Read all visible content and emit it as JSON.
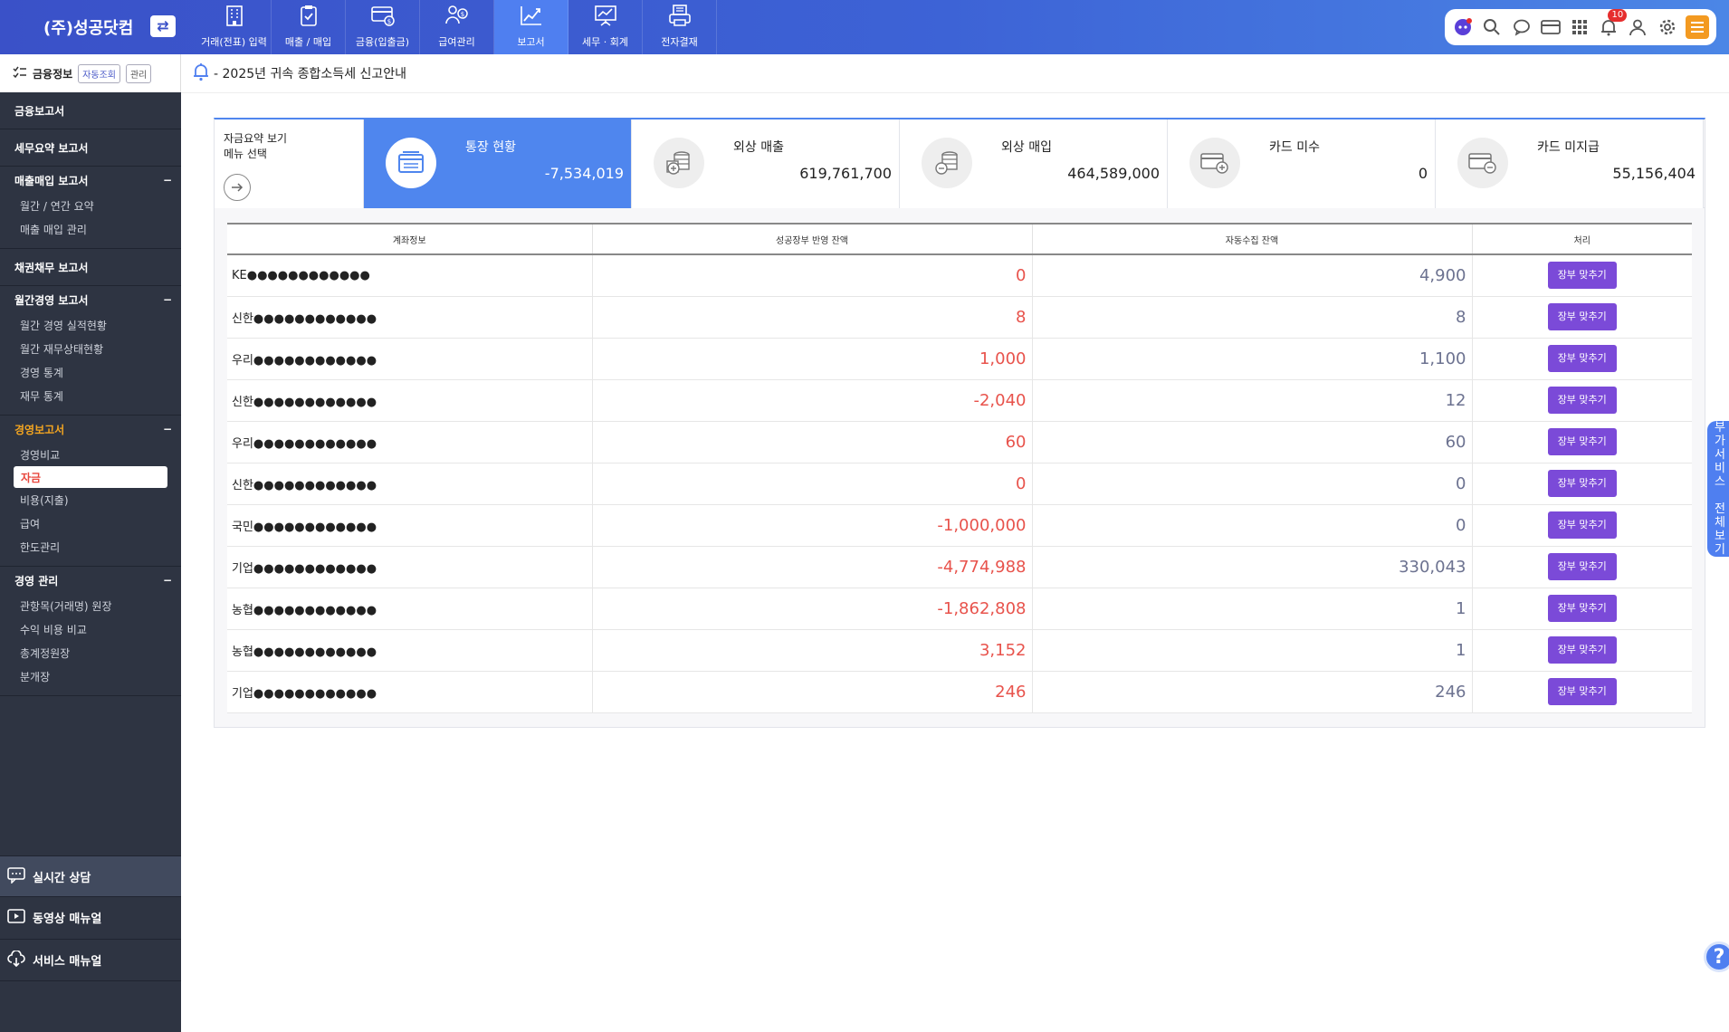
{
  "app": {
    "brand": "(주)성공닷컴"
  },
  "nav": [
    {
      "label": "거래(전표) 입력",
      "icon": "building-icon"
    },
    {
      "label": "매출 / 매입",
      "icon": "clipboard-check-icon"
    },
    {
      "label": "금융(입출금)",
      "icon": "card-money-icon"
    },
    {
      "label": "급여관리",
      "icon": "payroll-icon"
    },
    {
      "label": "보고서",
      "icon": "chart-up-icon"
    },
    {
      "label": "세무 · 회계",
      "icon": "presentation-icon"
    },
    {
      "label": "전자결재",
      "icon": "printer-doc-icon"
    }
  ],
  "nav_active": "보고서",
  "toolbar": {
    "notification_count": "10"
  },
  "sidebar": {
    "header": {
      "title": "금융정보",
      "chip_auto": "자동조회",
      "chip_manage": "관리"
    },
    "groups": [
      {
        "title": "금융보고서",
        "items": []
      },
      {
        "title": "세무요약 보고서",
        "items": []
      },
      {
        "title": "매출매입 보고서",
        "items": [
          "월간 / 연간 요약",
          "매출 매입 관리"
        ]
      },
      {
        "title": "채권채무 보고서",
        "items": []
      },
      {
        "title": "월간경영 보고서",
        "items": [
          "월간 경영 실적현황",
          "월간 재무상태현황",
          "경영 통계",
          "재무 통계"
        ]
      },
      {
        "title": "경영보고서",
        "items": [
          "경영비교",
          "자금",
          "비용(지출)",
          "급여",
          "한도관리"
        ]
      },
      {
        "title": "경영 관리",
        "items": [
          "관항목(거래명) 원장",
          "수익 비용 비교",
          "총계정원장",
          "분개장"
        ]
      }
    ],
    "active_item": "자금",
    "bottom": [
      {
        "label": "실시간 상담",
        "icon": "chat-icon"
      },
      {
        "label": "동영상 매뉴얼",
        "icon": "video-icon"
      },
      {
        "label": "서비스 매뉴얼",
        "icon": "cloud-download-icon"
      }
    ]
  },
  "notice": {
    "text": "- 2025년 귀속 종합소득세 신고안내"
  },
  "summary": {
    "menu_label_line1": "자금요약 보기",
    "menu_label_line2": "메뉴 선택",
    "cards": [
      {
        "title": "통장 현황",
        "value": "-7,534,019",
        "icon": "bankbook-icon"
      },
      {
        "title": "외상 매출",
        "value": "619,761,700",
        "icon": "coins-plus-icon"
      },
      {
        "title": "외상 매입",
        "value": "464,589,000",
        "icon": "coins-minus-icon"
      },
      {
        "title": "카드 미수",
        "value": "0",
        "icon": "card-plus-icon"
      },
      {
        "title": "카드 미지급",
        "value": "55,156,404",
        "icon": "card-minus-icon"
      }
    ]
  },
  "table": {
    "headers": [
      "계좌정보",
      "성공장부 반영 잔액",
      "자동수집 잔액",
      "처리"
    ],
    "button_label": "장부 맞추기",
    "rows": [
      {
        "account": "KE●●●●●●●●●●●●",
        "ledger": "0",
        "auto": "4,900"
      },
      {
        "account": "신한●●●●●●●●●●●●",
        "ledger": "8",
        "auto": "8"
      },
      {
        "account": "우리●●●●●●●●●●●●",
        "ledger": "1,000",
        "auto": "1,100"
      },
      {
        "account": "신한●●●●●●●●●●●●",
        "ledger": "-2,040",
        "auto": "12"
      },
      {
        "account": "우리●●●●●●●●●●●●",
        "ledger": "60",
        "auto": "60"
      },
      {
        "account": "신한●●●●●●●●●●●●",
        "ledger": "0",
        "auto": "0"
      },
      {
        "account": "국민●●●●●●●●●●●●",
        "ledger": "-1,000,000",
        "auto": "0"
      },
      {
        "account": "기업●●●●●●●●●●●●",
        "ledger": "-4,774,988",
        "auto": "330,043"
      },
      {
        "account": "농협●●●●●●●●●●●●",
        "ledger": "-1,862,808",
        "auto": "1"
      },
      {
        "account": "농협●●●●●●●●●●●●",
        "ledger": "3,152",
        "auto": "1"
      },
      {
        "account": "기업●●●●●●●●●●●●",
        "ledger": "246",
        "auto": "246"
      }
    ]
  },
  "side_tab": {
    "line1": "부가서비스",
    "line2": "전체보기"
  },
  "help": {
    "label": "?"
  },
  "colors": {
    "topbar": "#3a51c8",
    "accent": "#4f86ee",
    "sidebar": "#2e3442",
    "negative": "#e8534c",
    "button": "#7b4ad8",
    "highlight": "#f3a521"
  }
}
